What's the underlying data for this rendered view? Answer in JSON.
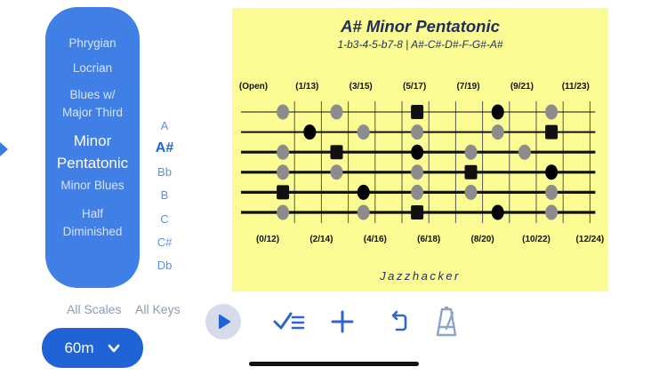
{
  "scales": [
    {
      "label": "Phrygian",
      "selected": false
    },
    {
      "label": "Locrian",
      "selected": false
    },
    {
      "label": "Blues w/ Major Third",
      "lines": [
        "Blues w/",
        "Major Third"
      ],
      "selected": false
    },
    {
      "label": "Minor Pentatonic",
      "lines": [
        "Minor",
        "Pentatonic"
      ],
      "selected": true
    },
    {
      "label": "Minor Blues",
      "selected": false
    },
    {
      "label": "Half Diminished",
      "lines": [
        "Half",
        "Diminished"
      ],
      "selected": false
    }
  ],
  "keys": [
    {
      "label": "A",
      "selected": false
    },
    {
      "label": "A#",
      "selected": true
    },
    {
      "label": "Bb",
      "selected": false
    },
    {
      "label": "B",
      "selected": false
    },
    {
      "label": "C",
      "selected": false
    },
    {
      "label": "C#",
      "selected": false
    },
    {
      "label": "Db",
      "selected": false
    }
  ],
  "all_scales_label": "All Scales",
  "all_keys_label": "All Keys",
  "tempo": {
    "label": "60m"
  },
  "chart": {
    "title": "A# Minor Pentatonic",
    "formula": "1-b3-4-5-b7-8 | A#-C#-D#-F-G#-A#",
    "brand": "Jazzhacker",
    "top_fret_labels": [
      "(Open)",
      "(1/13)",
      "(3/15)",
      "(5/17)",
      "(7/19)",
      "(9/21)",
      "(11/23)"
    ],
    "bottom_fret_labels": [
      "(0/12)",
      "(2/14)",
      "(4/16)",
      "(6/18)",
      "(8/20)",
      "(10/22)",
      "(12/24)"
    ],
    "strings": 6,
    "frets": 12,
    "notes": [
      {
        "fret": 1,
        "string": 1,
        "kind": "gray"
      },
      {
        "fret": 3,
        "string": 1,
        "kind": "gray"
      },
      {
        "fret": 6,
        "string": 1,
        "kind": "root"
      },
      {
        "fret": 9,
        "string": 1,
        "kind": "black"
      },
      {
        "fret": 11,
        "string": 1,
        "kind": "gray"
      },
      {
        "fret": 2,
        "string": 2,
        "kind": "black"
      },
      {
        "fret": 4,
        "string": 2,
        "kind": "gray"
      },
      {
        "fret": 6,
        "string": 2,
        "kind": "gray"
      },
      {
        "fret": 9,
        "string": 2,
        "kind": "gray"
      },
      {
        "fret": 11,
        "string": 2,
        "kind": "root"
      },
      {
        "fret": 1,
        "string": 3,
        "kind": "gray"
      },
      {
        "fret": 3,
        "string": 3,
        "kind": "root"
      },
      {
        "fret": 6,
        "string": 3,
        "kind": "black"
      },
      {
        "fret": 8,
        "string": 3,
        "kind": "gray"
      },
      {
        "fret": 10,
        "string": 3,
        "kind": "gray"
      },
      {
        "fret": 1,
        "string": 4,
        "kind": "gray"
      },
      {
        "fret": 3,
        "string": 4,
        "kind": "gray"
      },
      {
        "fret": 6,
        "string": 4,
        "kind": "gray"
      },
      {
        "fret": 8,
        "string": 4,
        "kind": "root"
      },
      {
        "fret": 11,
        "string": 4,
        "kind": "black"
      },
      {
        "fret": 1,
        "string": 5,
        "kind": "root"
      },
      {
        "fret": 4,
        "string": 5,
        "kind": "black"
      },
      {
        "fret": 6,
        "string": 5,
        "kind": "gray"
      },
      {
        "fret": 8,
        "string": 5,
        "kind": "gray"
      },
      {
        "fret": 11,
        "string": 5,
        "kind": "gray"
      },
      {
        "fret": 1,
        "string": 6,
        "kind": "gray"
      },
      {
        "fret": 4,
        "string": 6,
        "kind": "gray"
      },
      {
        "fret": 6,
        "string": 6,
        "kind": "root"
      },
      {
        "fret": 9,
        "string": 6,
        "kind": "black"
      },
      {
        "fret": 11,
        "string": 6,
        "kind": "gray"
      }
    ]
  },
  "toolbar": [
    {
      "name": "play-button",
      "icon": "play-icon"
    },
    {
      "name": "checklist-button",
      "icon": "checklist-icon"
    },
    {
      "name": "add-button",
      "icon": "plus-icon"
    },
    {
      "name": "rotate-button",
      "icon": "rotate-icon"
    },
    {
      "name": "metronome-button",
      "icon": "metronome-icon"
    }
  ],
  "colors": {
    "accent": "#3f7fe6",
    "accent_dark": "#1f63d6",
    "chart_bg": "#fbfb94",
    "note_gray": "#8c8c8c",
    "note_black": "#000000"
  }
}
